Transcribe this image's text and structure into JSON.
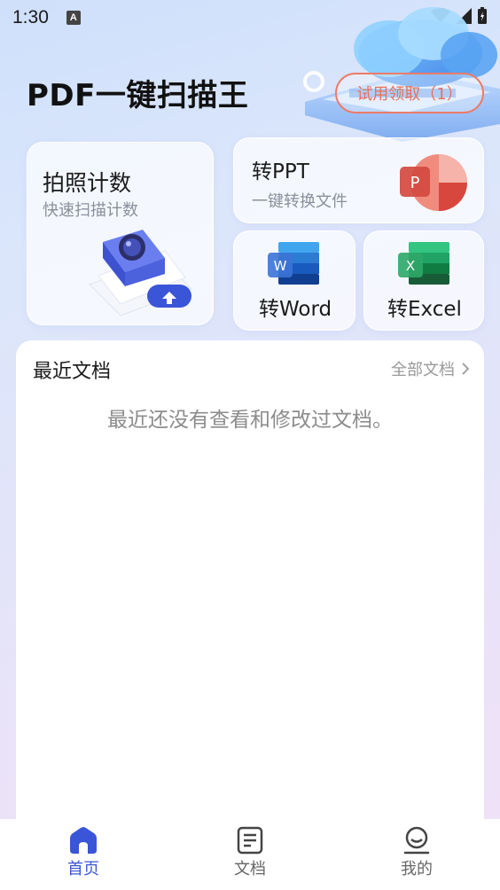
{
  "status_bar": {
    "time": "1:30",
    "notification_icon": "A"
  },
  "app": {
    "title": "PDF一键扫描王"
  },
  "trial": {
    "label": "试用领取（1）"
  },
  "cards": {
    "photo_count": {
      "title": "拍照计数",
      "subtitle": "快速扫描计数",
      "icon": "camera-scan-icon"
    },
    "ppt": {
      "title": "转PPT",
      "subtitle": "一键转换文件",
      "icon": "powerpoint-icon",
      "icon_letter": "P"
    },
    "word": {
      "title": "转Word",
      "icon": "word-icon",
      "icon_letter": "W"
    },
    "excel": {
      "title": "转Excel",
      "icon": "excel-icon",
      "icon_letter": "X"
    }
  },
  "recent": {
    "title": "最近文档",
    "all_docs": "全部文档",
    "empty": "最近还没有查看和修改过文档。"
  },
  "nav": {
    "items": [
      {
        "label": "首页",
        "icon": "home-icon",
        "active": true
      },
      {
        "label": "文档",
        "icon": "document-icon",
        "active": false
      },
      {
        "label": "我的",
        "icon": "profile-icon",
        "active": false
      }
    ]
  },
  "colors": {
    "accent": "#3a55d8",
    "trial": "#e8705b",
    "ppt": "#e2524a",
    "word": "#2b64d4",
    "excel": "#1e8a52"
  }
}
